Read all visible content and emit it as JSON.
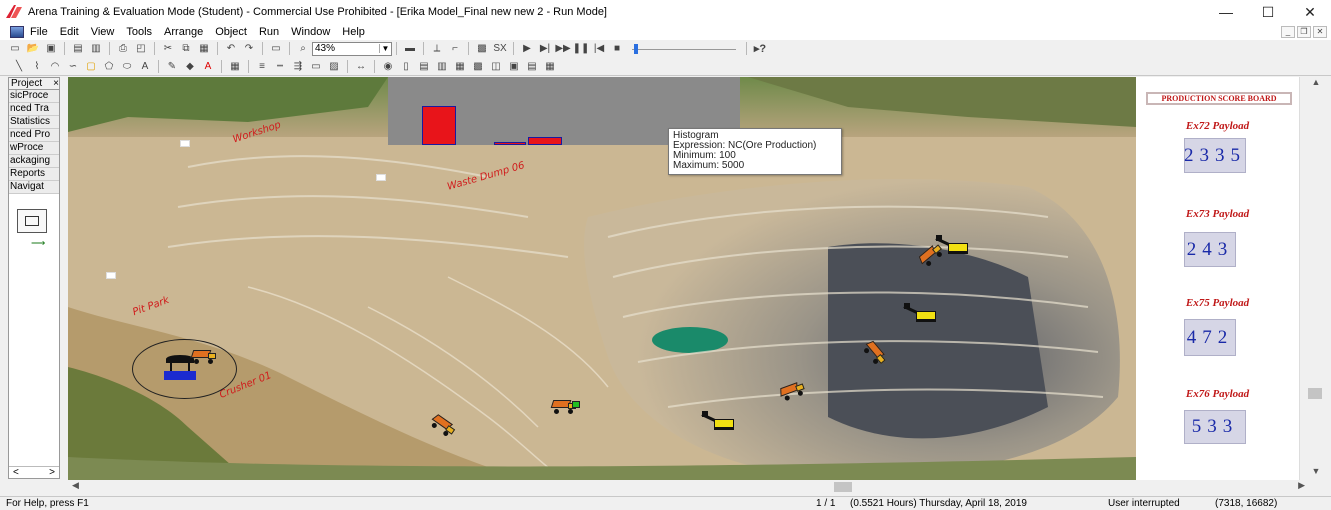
{
  "window": {
    "title": "Arena Training & Evaluation Mode (Student) - Commercial Use Prohibited - [Erika Model_Final new new 2 - Run Mode]",
    "minimize": "—",
    "maximize": "☐",
    "close": "✕"
  },
  "menu": {
    "items": [
      "File",
      "Edit",
      "View",
      "Tools",
      "Arrange",
      "Object",
      "Run",
      "Window",
      "Help"
    ]
  },
  "toolbar": {
    "zoom_value": "43%"
  },
  "project_bar": {
    "title": "Project",
    "close": "×",
    "items": [
      "sicProce",
      "nced Tra",
      "Statistics",
      "nced Pro",
      "wProce",
      "ackaging",
      "Reports",
      "Navigat"
    ],
    "nav_left": "<",
    "nav_right": ">"
  },
  "histogram": {
    "tooltip_title": "Histogram",
    "tooltip_expression": "Expression: NC(Ore Production)",
    "tooltip_minimum": "Minimum: 100",
    "tooltip_maximum": "Maximum: 5000",
    "bars_relative": [
      0.58,
      0.04,
      0.12
    ]
  },
  "map_labels": {
    "workshop": "Workshop",
    "waste_dump": "Waste Dump 06",
    "pit_park": "Pit Park",
    "crusher": "Crusher 01"
  },
  "scoreboard": {
    "title": "PRODUCTION SCORE BOARD",
    "entries": [
      {
        "label": "Ex72 Payload",
        "value": "2335"
      },
      {
        "label": "Ex73 Payload",
        "value": "243"
      },
      {
        "label": "Ex75 Payload",
        "value": "472"
      },
      {
        "label": "Ex76 Payload",
        "value": "533"
      }
    ]
  },
  "status": {
    "help": "For Help, press F1",
    "replication": "1 / 1",
    "sim_time": "(0.5521 Hours) Thursday, April 18, 2019",
    "state": "User interrupted",
    "coords": "(7318, 16682)"
  },
  "colors": {
    "label_red": "#c01818",
    "score_blue": "#1a2aa8",
    "histogram_bg": "#8a8a8a",
    "histogram_bar": "#e8141a"
  }
}
